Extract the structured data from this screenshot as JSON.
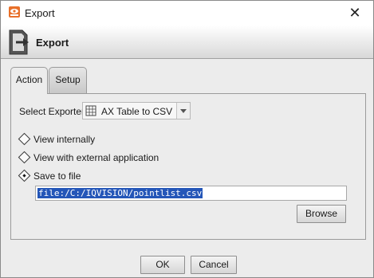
{
  "window": {
    "title": "Export"
  },
  "header": {
    "title": "Export"
  },
  "tabs": [
    {
      "label": "Action",
      "selected": true
    },
    {
      "label": "Setup",
      "selected": false
    }
  ],
  "action": {
    "exporter_label": "Select Exporter",
    "exporter_value": "AX Table to CSV",
    "options": [
      {
        "label": "View internally",
        "selected": false
      },
      {
        "label": "View with external application",
        "selected": false
      },
      {
        "label": "Save to file",
        "selected": true
      }
    ],
    "file_path": "file:/C:/IQVISION/pointlist.csv",
    "browse_label": "Browse"
  },
  "footer": {
    "ok_label": "OK",
    "cancel_label": "Cancel"
  },
  "colors": {
    "selection": "#2456b8",
    "app_icon": "#e8702a"
  },
  "icons": {
    "app": "eye-app-icon",
    "header": "export-document-icon",
    "exporter": "table-csv-icon",
    "close": "close-icon",
    "dropdown": "chevron-down-icon"
  }
}
